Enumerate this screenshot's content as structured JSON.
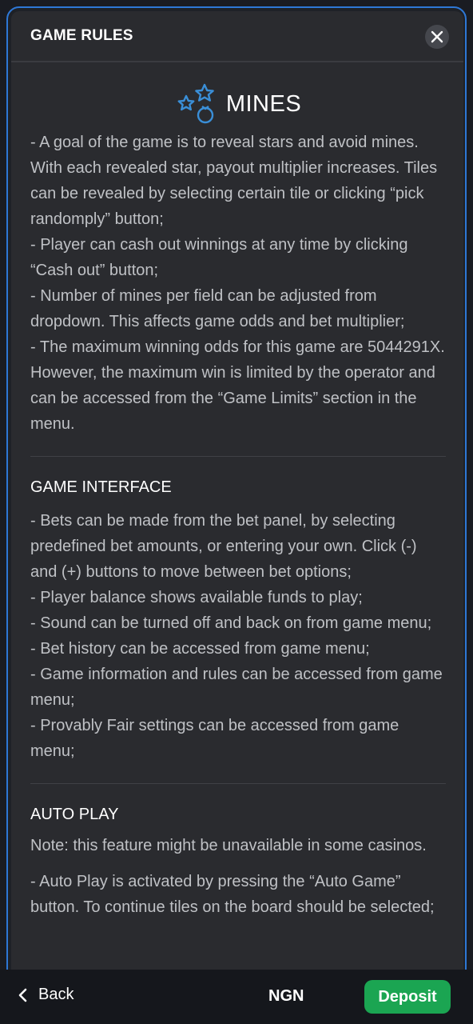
{
  "header": {
    "title": "GAME RULES"
  },
  "game": {
    "title": "MINES"
  },
  "rules": [
    "- A goal of the game is to reveal stars and avoid mines. With each revealed star, payout multiplier increases. Tiles can be revealed by selecting certain tile or clicking “pick randomply” button;",
    "- Player can cash out winnings at any time by clicking “Cash out” button;",
    "- Number of mines per field can be adjusted from dropdown. This affects game odds and bet multiplier;",
    "- The maximum winning odds for this game are 5044291X. However, the maximum win is limited by the operator and can be accessed from the “Game Limits” section in the menu."
  ],
  "interface": {
    "title": "GAME INTERFACE",
    "items": [
      "- Bets can be made from the bet panel, by selecting predefined bet amounts, or entering your own. Click (-) and (+) buttons to move between bet options;",
      "- Player balance shows available funds to play;",
      "- Sound can be turned off and back on from game menu;",
      "- Bet history can be accessed from game menu;",
      "- Game information and rules can be accessed from game menu;",
      "- Provably Fair settings can be accessed from game menu;"
    ]
  },
  "autoplay": {
    "title": "AUTO PLAY",
    "note": "Note: this feature might be unavailable in some casinos.",
    "items": [
      "- Auto Play is activated by pressing the “Auto Game” button. To continue tiles on the board should be selected;"
    ]
  },
  "bottom_bar": {
    "back_label": "Back",
    "currency": "NGN",
    "deposit_label": "Deposit"
  },
  "colors": {
    "accent_blue": "#2e78d6",
    "deposit_green": "#1ba552",
    "modal_bg": "#2a2b2f"
  }
}
